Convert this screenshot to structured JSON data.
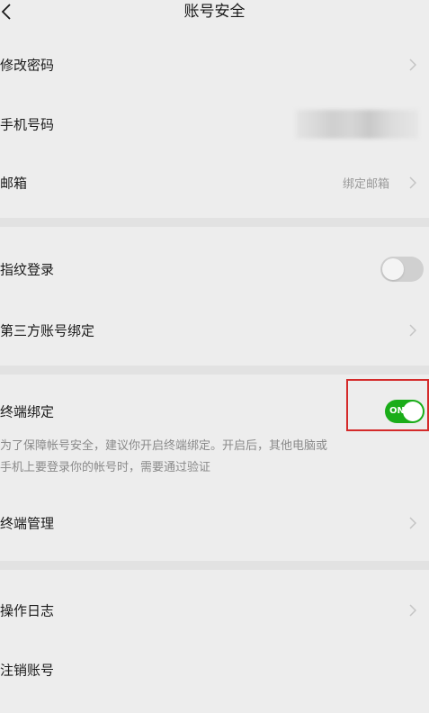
{
  "header": {
    "title": "账号安全",
    "back_icon": "chevron-left-icon"
  },
  "section1": {
    "change_password": {
      "label": "修改密码"
    },
    "phone_number": {
      "label": "手机号码",
      "value_state": "blurred"
    },
    "email": {
      "label": "邮箱",
      "value": "绑定邮箱"
    }
  },
  "section2": {
    "fingerprint_login": {
      "label": "指纹登录",
      "toggle": "off"
    },
    "third_party_binding": {
      "label": "第三方账号绑定"
    }
  },
  "section3": {
    "device_binding": {
      "label": "终端绑定",
      "toggle": "on",
      "toggle_text": "ON",
      "description_line1": "为了保障帐号安全，建议你开启终端绑定。开启后，其他电脑或",
      "description_line2": "手机上要登录你的帐号时，需要通过验证"
    },
    "device_management": {
      "label": "终端管理"
    }
  },
  "section4": {
    "operation_log": {
      "label": "操作日志"
    },
    "cancel_account": {
      "label": "注销账号"
    }
  },
  "colors": {
    "background": "#ededed",
    "divider": "#e2e2e2",
    "toggle_on": "#1aad19",
    "highlight": "#d42a2a"
  }
}
